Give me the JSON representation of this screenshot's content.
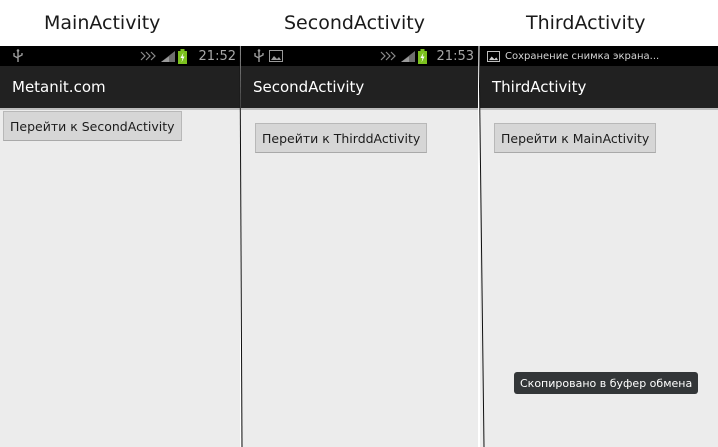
{
  "captions": [
    "MainActivity",
    "SecondActivity",
    "ThirdActivity"
  ],
  "screens": [
    {
      "status": {
        "left_icons": [
          "usb-icon"
        ],
        "time": "21:52"
      },
      "title": "Metanit.com",
      "button": "Перейти к SecondActivity"
    },
    {
      "status": {
        "left_icons": [
          "usb-icon",
          "image-icon"
        ],
        "time": "21:53"
      },
      "title": "SecondActivity",
      "button": "Перейти к ThirddActivity"
    },
    {
      "status": {
        "notification": "Сохранение снимка экрана..."
      },
      "title": "ThirdActivity",
      "button": "Перейти к MainActivity"
    }
  ],
  "toast": "Скопировано в буфер обмена",
  "colors": {
    "screen_background": "#ececec",
    "action_bar": "#212121",
    "status_bar": "#000000",
    "battery": "#7cc11e",
    "toast_background": "#333638"
  }
}
